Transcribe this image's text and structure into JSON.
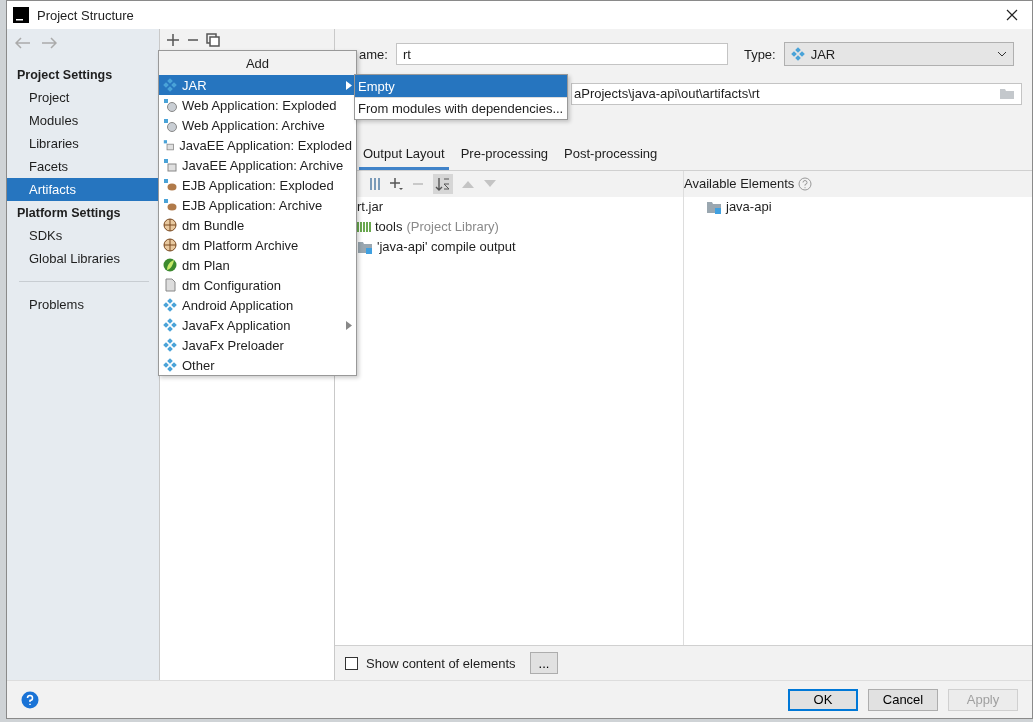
{
  "window": {
    "title": "Project Structure"
  },
  "nav": {
    "sections": [
      {
        "title": "Project Settings",
        "items": [
          {
            "label": "Project",
            "selected": false
          },
          {
            "label": "Modules",
            "selected": false
          },
          {
            "label": "Libraries",
            "selected": false
          },
          {
            "label": "Facets",
            "selected": false
          },
          {
            "label": "Artifacts",
            "selected": true
          }
        ]
      },
      {
        "title": "Platform Settings",
        "items": [
          {
            "label": "SDKs",
            "selected": false
          },
          {
            "label": "Global Libraries",
            "selected": false
          }
        ]
      }
    ],
    "bottom_items": [
      {
        "label": "Problems",
        "selected": false
      }
    ]
  },
  "add_menu": {
    "title": "Add",
    "items": [
      {
        "label": "JAR",
        "kind": "artifact",
        "selected": true,
        "submenu": true
      },
      {
        "label": "Web Application: Exploded",
        "kind": "web",
        "selected": false,
        "submenu": false
      },
      {
        "label": "Web Application: Archive",
        "kind": "web",
        "selected": false,
        "submenu": false
      },
      {
        "label": "JavaEE Application: Exploded",
        "kind": "javaee",
        "selected": false,
        "submenu": false
      },
      {
        "label": "JavaEE Application: Archive",
        "kind": "javaee",
        "selected": false,
        "submenu": false
      },
      {
        "label": "EJB Application: Exploded",
        "kind": "ejb",
        "selected": false,
        "submenu": false
      },
      {
        "label": "EJB Application: Archive",
        "kind": "ejb",
        "selected": false,
        "submenu": false
      },
      {
        "label": "dm Bundle",
        "kind": "bundle",
        "selected": false,
        "submenu": false
      },
      {
        "label": "dm Platform Archive",
        "kind": "bundle",
        "selected": false,
        "submenu": false
      },
      {
        "label": "dm Plan",
        "kind": "plan",
        "selected": false,
        "submenu": false
      },
      {
        "label": "dm Configuration",
        "kind": "config",
        "selected": false,
        "submenu": false
      },
      {
        "label": "Android Application",
        "kind": "artifact",
        "selected": false,
        "submenu": false
      },
      {
        "label": "JavaFx Application",
        "kind": "artifact",
        "selected": false,
        "submenu": true
      },
      {
        "label": "JavaFx Preloader",
        "kind": "artifact",
        "selected": false,
        "submenu": false
      },
      {
        "label": "Other",
        "kind": "artifact",
        "selected": false,
        "submenu": false
      }
    ]
  },
  "submenu": {
    "items": [
      {
        "label": "Empty",
        "selected": true
      },
      {
        "label": "From modules with dependencies...",
        "selected": false
      }
    ]
  },
  "name_field": {
    "label": "ame:",
    "value": "rt"
  },
  "type_field": {
    "label": "Type:",
    "value": "JAR"
  },
  "output_directory": {
    "value": "aProjects\\java-api\\out\\artifacts\\rt"
  },
  "tabs": [
    {
      "label": "Output Layout",
      "selected": true
    },
    {
      "label": "Pre-processing",
      "selected": false
    },
    {
      "label": "Post-processing",
      "selected": false
    }
  ],
  "layout_tree": [
    {
      "label": "rt.jar",
      "kind": "jar"
    },
    {
      "label": "tools",
      "note": "(Project Library)",
      "kind": "library"
    },
    {
      "label": "'java-api' compile output",
      "kind": "module"
    }
  ],
  "available_elements": {
    "title": "Available Elements",
    "items": [
      {
        "label": "java-api"
      }
    ]
  },
  "show_content": {
    "label": "Show content of elements",
    "checked": false
  },
  "more_button": "...",
  "buttons": [
    {
      "label": "OK",
      "kind": "default",
      "disabled": false
    },
    {
      "label": "Cancel",
      "kind": "normal",
      "disabled": false
    },
    {
      "label": "Apply",
      "kind": "normal",
      "disabled": true
    }
  ]
}
